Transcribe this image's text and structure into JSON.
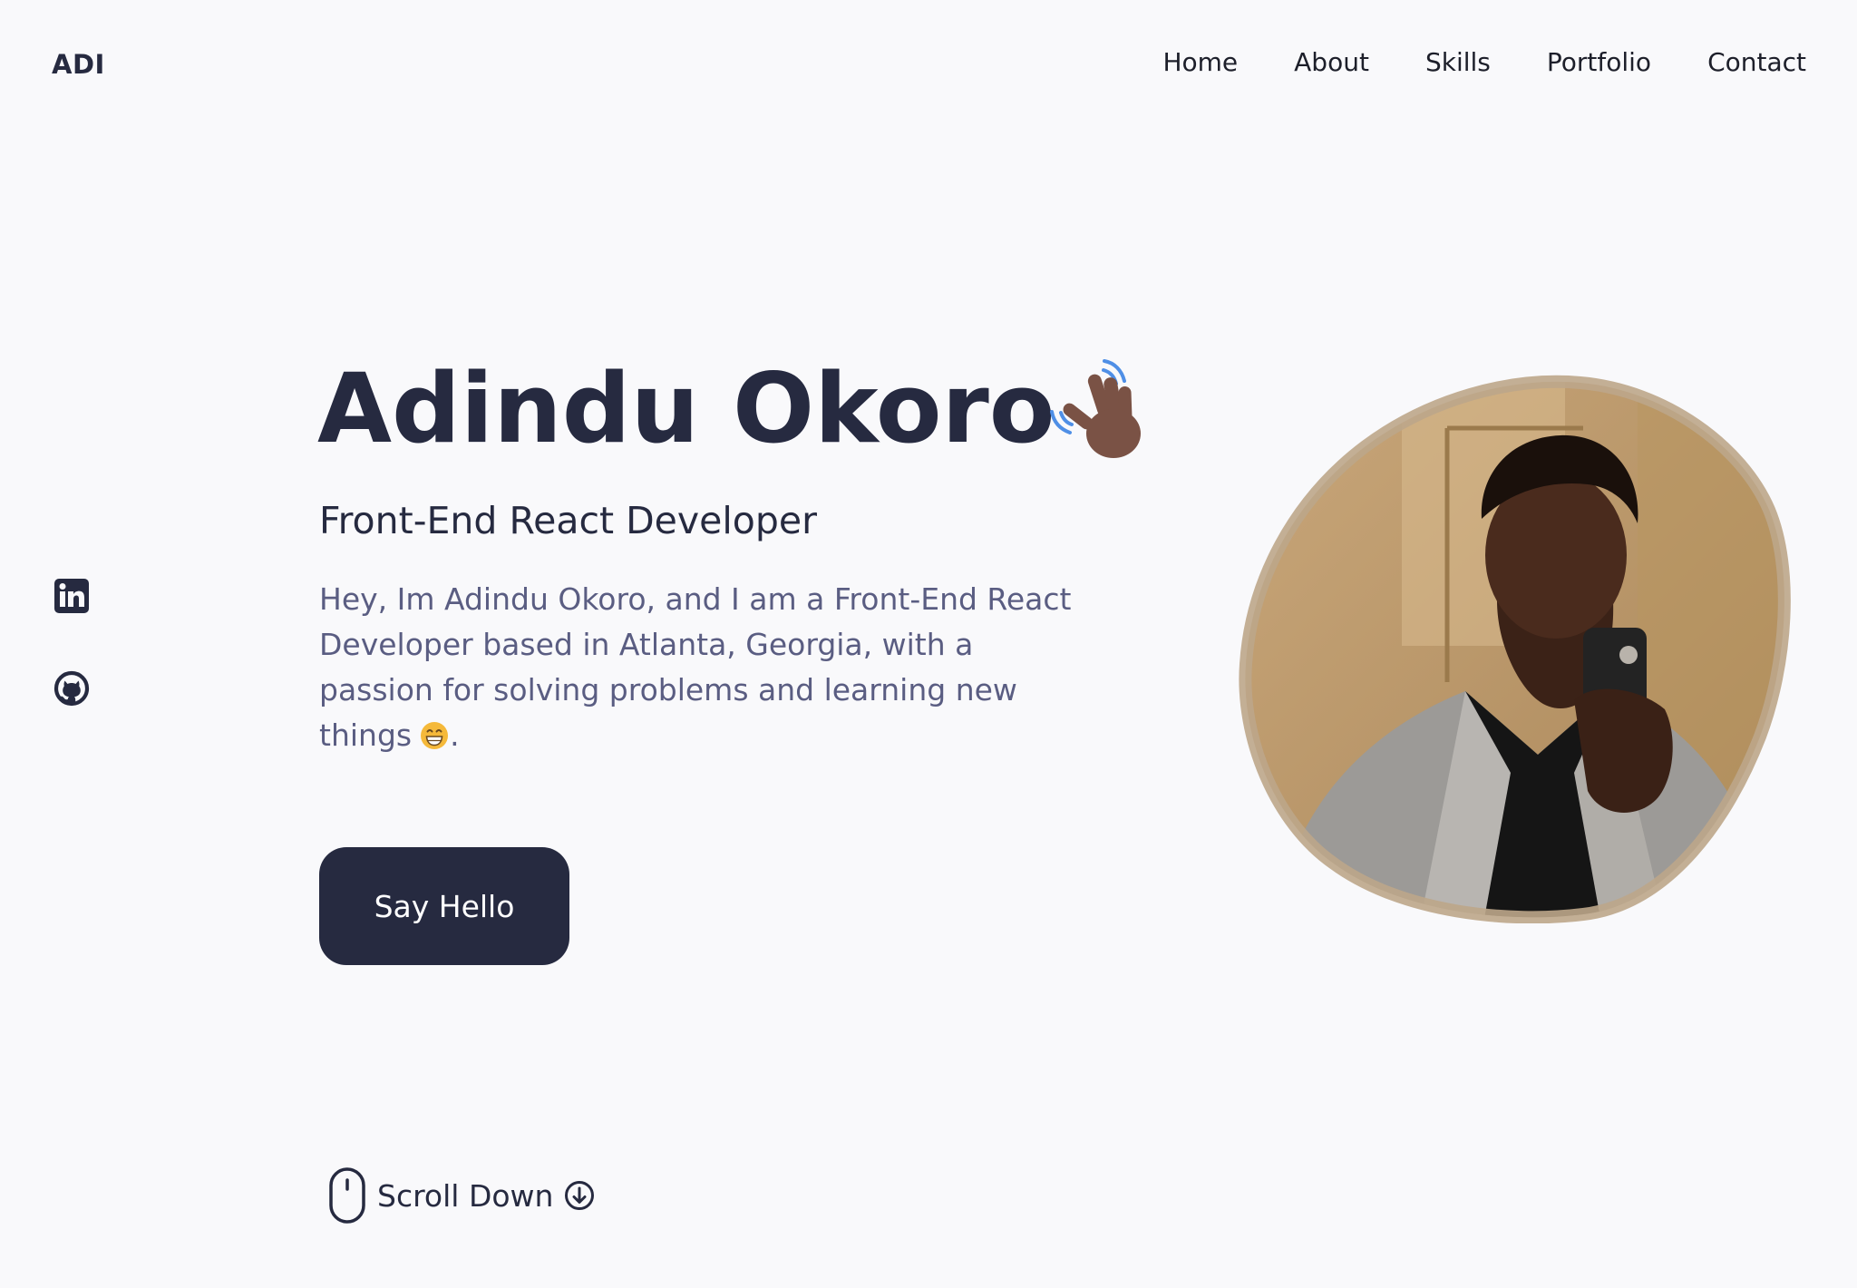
{
  "header": {
    "logo": "ADI",
    "nav": [
      "Home",
      "About",
      "Skills",
      "Portfolio",
      "Contact"
    ]
  },
  "social": {
    "linkedin_icon": "linkedin-icon",
    "github_icon": "github-icon"
  },
  "hero": {
    "name": "Adindu Okoro",
    "subtitle": "Front-End React Developer",
    "description": "Hey, Im Adindu Okoro, and I am a Front-End React Developer based in Atlanta, Georgia, with a passion for solving problems and learning new things",
    "description_end": ".",
    "button_label": "Say Hello",
    "scroll_label": "Scroll Down"
  },
  "colors": {
    "primary": "#262a40",
    "text_secondary": "#5a5d82",
    "background": "#f9f9fb"
  }
}
